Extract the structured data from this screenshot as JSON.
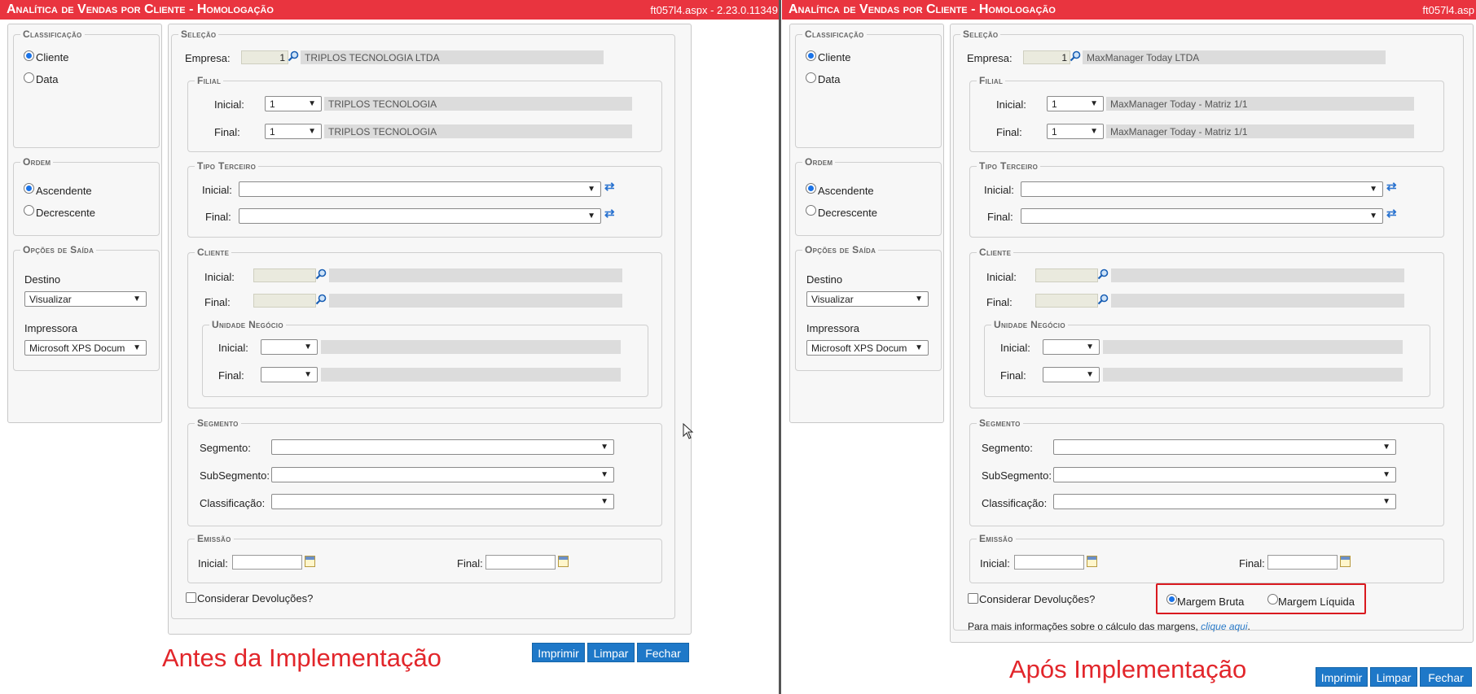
{
  "left": {
    "title": "Analítica de Vendas por Cliente  - Homologação",
    "version": "ft057l4.aspx - 2.23.0.11349",
    "classificacao": {
      "legend": "Classificação",
      "options": [
        "Cliente",
        "Data"
      ],
      "selected": "Cliente"
    },
    "ordem": {
      "legend": "Ordem",
      "options": [
        "Ascendente",
        "Decrescente"
      ],
      "selected": "Ascendente"
    },
    "opcoes_saida": {
      "legend": "Opções de Saída",
      "destino_label": "Destino",
      "destino_value": "Visualizar",
      "impressora_label": "Impressora",
      "impressora_value": "Microsoft XPS Docum"
    },
    "selecao": {
      "legend": "Seleção",
      "empresa_label": "Empresa:",
      "empresa_code": "1",
      "empresa_name": "TRIPLOS TECNOLOGIA LTDA",
      "filial": {
        "legend": "Filial",
        "inicial_label": "Inicial:",
        "final_label": "Final:",
        "inicial_value": "1",
        "final_value": "1",
        "inicial_name": "TRIPLOS TECNOLOGIA",
        "final_name": "TRIPLOS TECNOLOGIA"
      },
      "tipo_terceiro": {
        "legend": "Tipo Terceiro",
        "inicial_label": "Inicial:",
        "final_label": "Final:"
      },
      "cliente": {
        "legend": "Cliente",
        "inicial_label": "Inicial:",
        "final_label": "Final:",
        "unidade": {
          "legend": "Unidade Negócio",
          "inicial_label": "Inicial:",
          "final_label": "Final:"
        }
      },
      "segmento": {
        "legend": "Segmento",
        "segmento_label": "Segmento:",
        "subsegmento_label": "SubSegmento:",
        "classificacao_label": "Classificação:"
      },
      "emissao": {
        "legend": "Emissão",
        "inicial_label": "Inicial:",
        "final_label": "Final:"
      },
      "devolucoes_label": "Considerar Devoluções?"
    },
    "buttons": {
      "imprimir": "Imprimir",
      "limpar": "Limpar",
      "fechar": "Fechar"
    },
    "caption": "Antes da Implementação"
  },
  "right": {
    "title": "Analítica de Vendas por Cliente  - Homologação",
    "version": "ft057l4.asp",
    "classificacao": {
      "legend": "Classificação",
      "options": [
        "Cliente",
        "Data"
      ],
      "selected": "Cliente"
    },
    "ordem": {
      "legend": "Ordem",
      "options": [
        "Ascendente",
        "Decrescente"
      ],
      "selected": "Ascendente"
    },
    "opcoes_saida": {
      "legend": "Opções de Saída",
      "destino_label": "Destino",
      "destino_value": "Visualizar",
      "impressora_label": "Impressora",
      "impressora_value": "Microsoft XPS Docum"
    },
    "selecao": {
      "legend": "Seleção",
      "empresa_label": "Empresa:",
      "empresa_code": "1",
      "empresa_name": "MaxManager Today LTDA",
      "filial": {
        "legend": "Filial",
        "inicial_label": "Inicial:",
        "final_label": "Final:",
        "inicial_value": "1",
        "final_value": "1",
        "inicial_name": "MaxManager Today - Matriz 1/1",
        "final_name": "MaxManager Today - Matriz 1/1"
      },
      "tipo_terceiro": {
        "legend": "Tipo Terceiro",
        "inicial_label": "Inicial:",
        "final_label": "Final:"
      },
      "cliente": {
        "legend": "Cliente",
        "inicial_label": "Inicial:",
        "final_label": "Final:",
        "unidade": {
          "legend": "Unidade Negócio",
          "inicial_label": "Inicial:",
          "final_label": "Final:"
        }
      },
      "segmento": {
        "legend": "Segmento",
        "segmento_label": "Segmento:",
        "subsegmento_label": "SubSegmento:",
        "classificacao_label": "Classificação:"
      },
      "emissao": {
        "legend": "Emissão",
        "inicial_label": "Inicial:",
        "final_label": "Final:"
      },
      "devolucoes_label": "Considerar Devoluções?",
      "margem": {
        "options": [
          "Margem Bruta",
          "Margem Líquida"
        ],
        "selected": "Margem Bruta"
      },
      "info_text": "Para mais informações sobre o cálculo das margens, ",
      "info_link": "clique aqui",
      "info_end": "."
    },
    "buttons": {
      "imprimir": "Imprimir",
      "limpar": "Limpar",
      "fechar": "Fechar"
    },
    "caption": "Após Implementação"
  },
  "colors": {
    "titlebar": "#e9343f",
    "button": "#1e78c8",
    "caption": "#e2262b",
    "highlight": "#d9191f",
    "link": "#2a7ac8"
  }
}
